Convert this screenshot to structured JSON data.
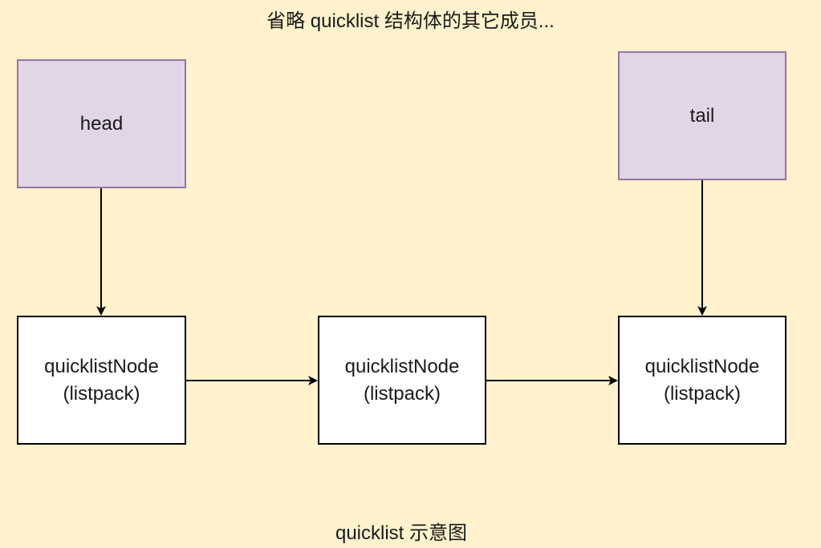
{
  "header": {
    "title": "省略 quicklist 结构体的其它成员..."
  },
  "pointers": {
    "head_label": "head",
    "tail_label": "tail"
  },
  "nodes": [
    {
      "name": "quicklistNode",
      "type": "(listpack)"
    },
    {
      "name": "quicklistNode",
      "type": "(listpack)"
    },
    {
      "name": "quicklistNode",
      "type": "(listpack)"
    }
  ],
  "footer": {
    "caption": "quicklist 示意图"
  },
  "colors": {
    "background": "#FFF2CC",
    "pointer_fill": "#E1D5E7",
    "pointer_border": "#9673A6",
    "node_fill": "#FFFFFF",
    "node_border": "#000000",
    "arrow": "#000000"
  }
}
